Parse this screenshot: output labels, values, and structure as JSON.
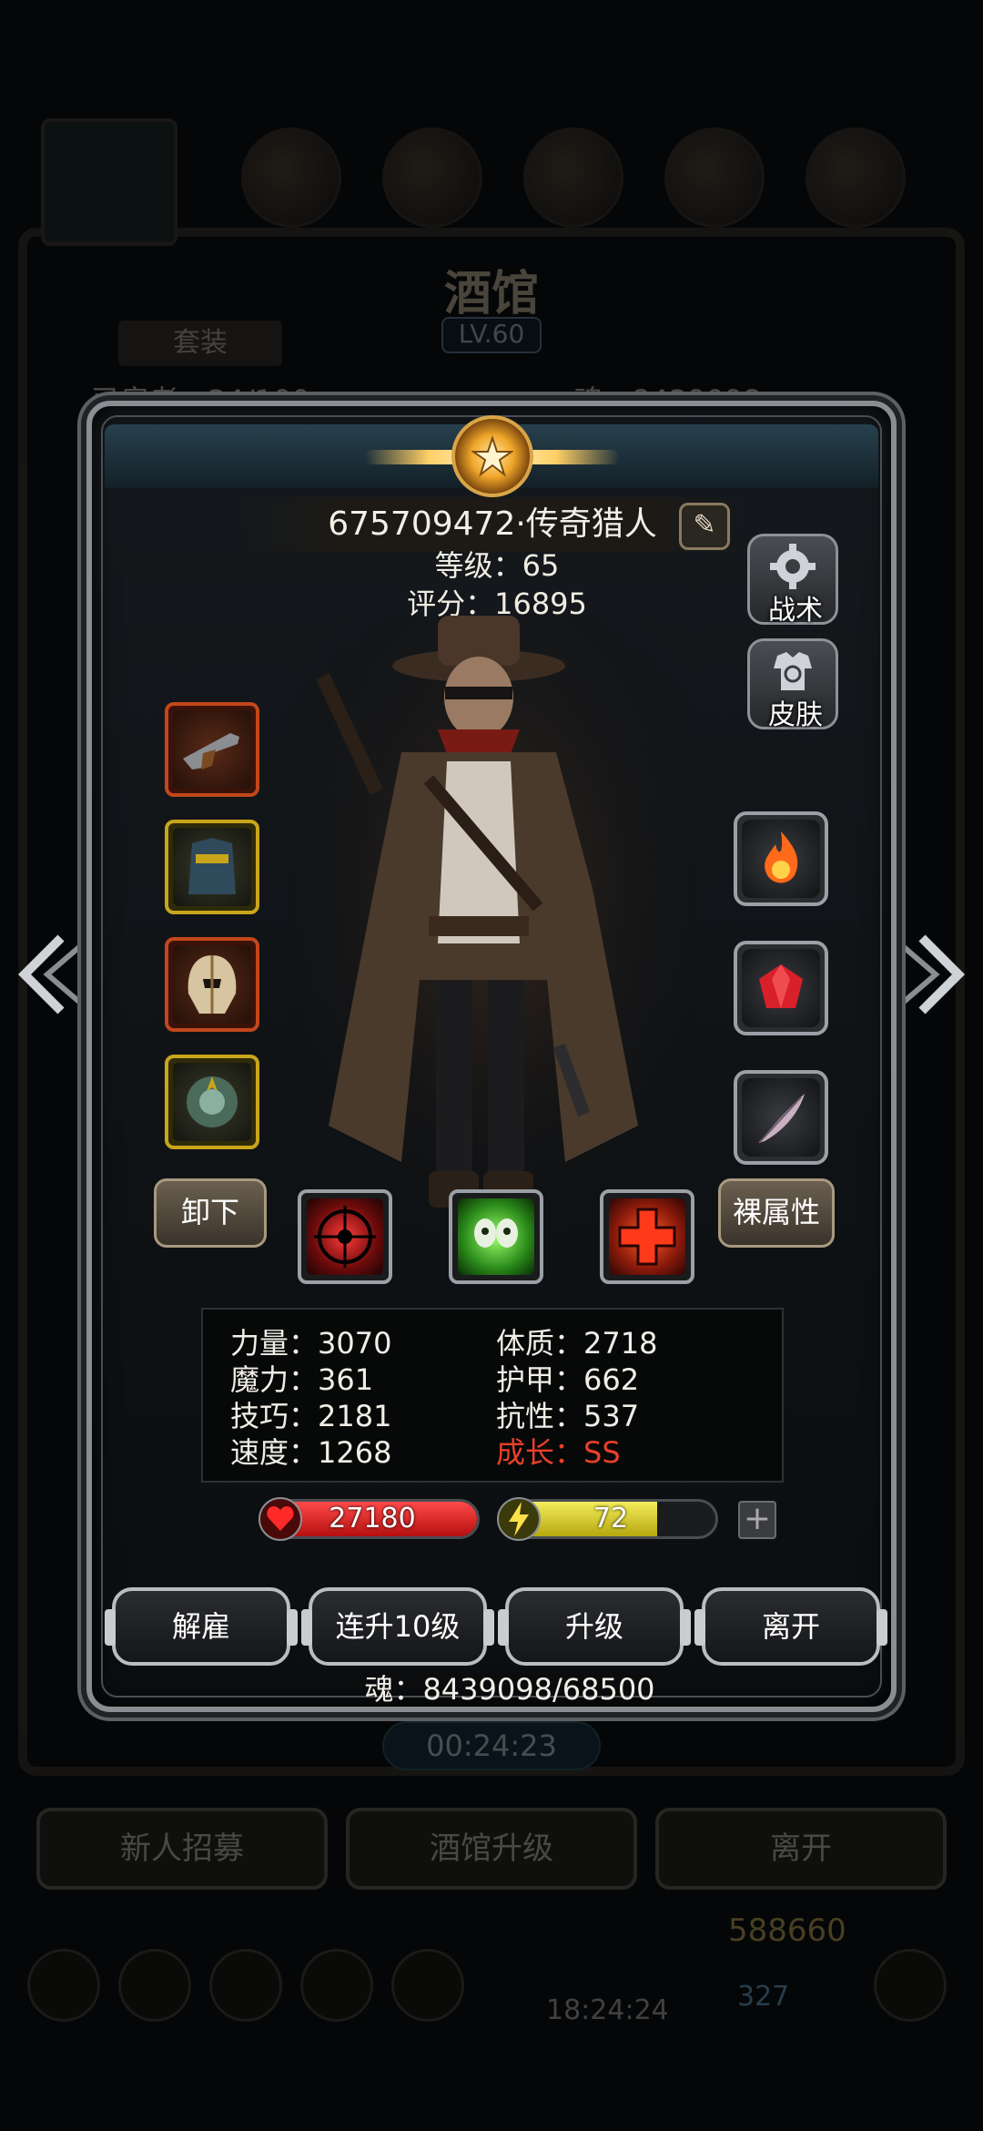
{
  "background": {
    "title": "酒馆",
    "level": "LV.60",
    "suit_tab": "套装",
    "recruit_count": "已雇者：34/100",
    "soul": "魂：8439098",
    "timer": "00:24:23",
    "buttons": [
      "新人招募",
      "酒馆升级",
      "离开"
    ],
    "gold": "588660",
    "gems": "327",
    "clock": "18:24:24"
  },
  "hero": {
    "name": "675709472·传奇猎人",
    "level": "等级：65",
    "score": "评分：16895"
  },
  "side_buttons": {
    "tactics": "战术",
    "skin": "皮肤"
  },
  "equipment": {
    "left": [
      "flintlock-rifle",
      "blue-cloak-armor",
      "winged-helmet",
      "bronze-amulet"
    ],
    "right": [
      "fire-orb",
      "red-gem",
      "feather-quill"
    ]
  },
  "actions": {
    "unequip": "卸下",
    "naked_attributes": "裸属性"
  },
  "skills": [
    "red-target-skill",
    "green-poison-skill",
    "red-cross-skill"
  ],
  "stats": {
    "strength": "力量：3070",
    "magic": "魔力：361",
    "skill": "技巧：2181",
    "speed": "速度：1268",
    "constitution": "体质：2718",
    "armor": "护甲：662",
    "resistance": "抗性：537",
    "growth": "成长：SS"
  },
  "bars": {
    "hp": "27180",
    "hp_fill": 1.0,
    "energy": "72",
    "energy_fill": 0.72
  },
  "bottom_buttons": {
    "dismiss": "解雇",
    "upgrade10": "连升10级",
    "upgrade": "升级",
    "leave": "离开"
  },
  "soul_cost": "魂：8439098/68500",
  "colors": {
    "growth": "#e8402a",
    "hp": "#d81e1e",
    "energy": "#d9cf2a",
    "slot_red": "#c2471a",
    "slot_gold": "#c9a51a"
  }
}
